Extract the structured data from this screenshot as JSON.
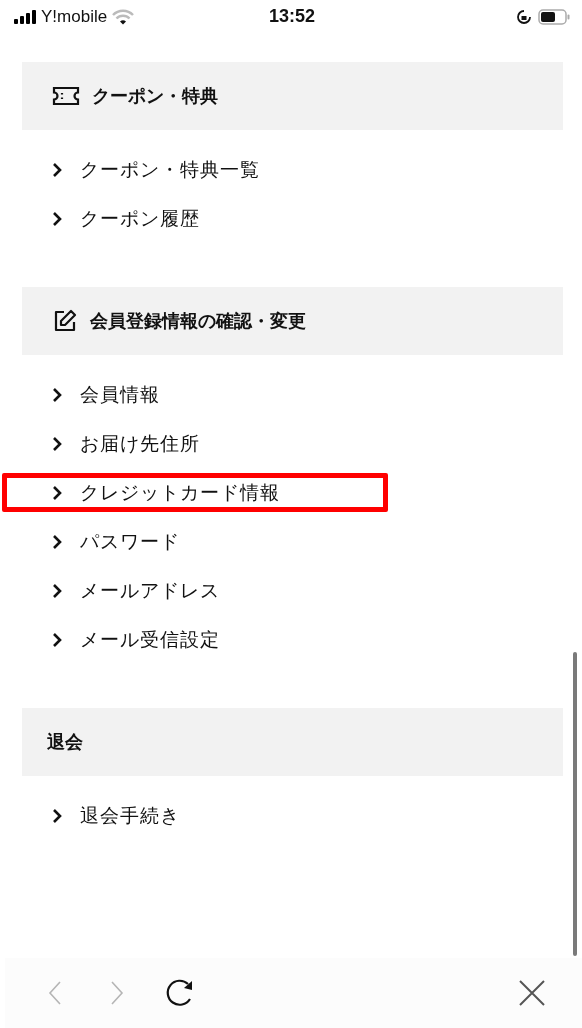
{
  "status_bar": {
    "carrier": "Y!mobile",
    "time": "13:52"
  },
  "sections": [
    {
      "title": "クーポン・特典",
      "kind": "ticket",
      "items": [
        {
          "label": "クーポン・特典一覧",
          "highlighted": false
        },
        {
          "label": "クーポン履歴",
          "highlighted": false
        }
      ]
    },
    {
      "title": "会員登録情報の確認・変更",
      "kind": "edit",
      "items": [
        {
          "label": "会員情報",
          "highlighted": false
        },
        {
          "label": "お届け先住所",
          "highlighted": false
        },
        {
          "label": "クレジットカード情報",
          "highlighted": true
        },
        {
          "label": "パスワード",
          "highlighted": false
        },
        {
          "label": "メールアドレス",
          "highlighted": false
        },
        {
          "label": "メール受信設定",
          "highlighted": false
        }
      ]
    },
    {
      "title": "退会",
      "kind": "plain",
      "items": [
        {
          "label": "退会手続き",
          "highlighted": false
        }
      ]
    }
  ],
  "toolbar": [
    {
      "kind": "back",
      "disabled": true
    },
    {
      "kind": "forward",
      "disabled": true
    },
    {
      "kind": "reload",
      "disabled": false
    },
    {
      "kind": "close",
      "disabled": false
    }
  ]
}
